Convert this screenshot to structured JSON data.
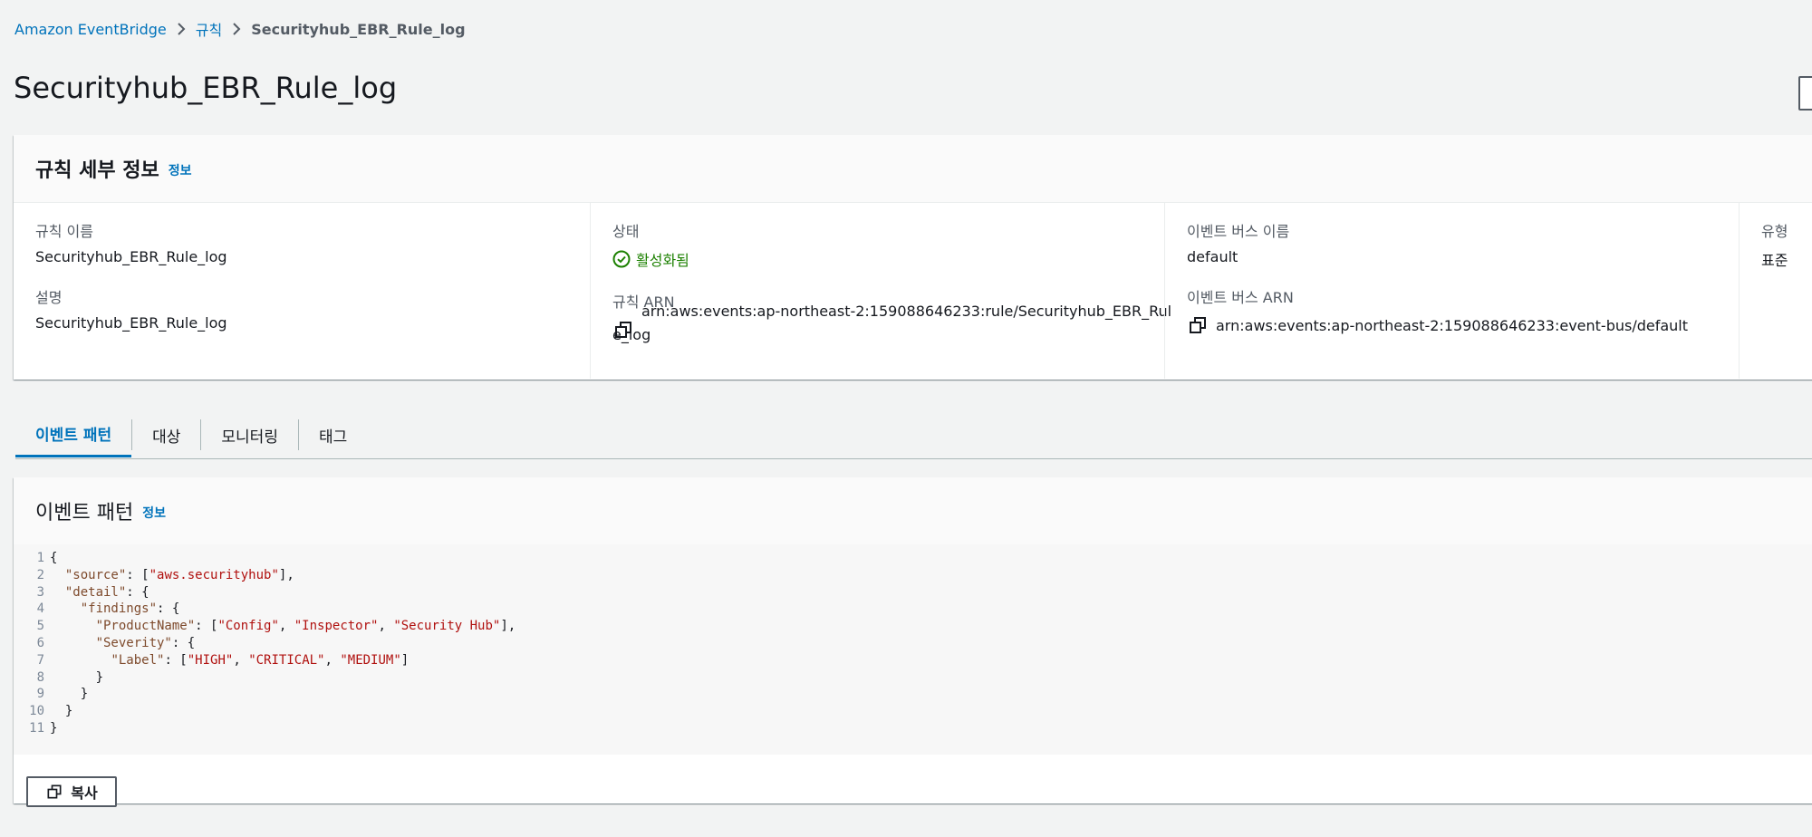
{
  "breadcrumb": {
    "items": [
      "Amazon EventBridge",
      "규칙"
    ],
    "current": "Securityhub_EBR_Rule_log"
  },
  "page_title": "Securityhub_EBR_Rule_log",
  "rule_details": {
    "title": "규칙 세부 정보",
    "info_label": "정보",
    "rule_name_label": "규칙 이름",
    "rule_name": "Securityhub_EBR_Rule_log",
    "description_label": "설명",
    "description": "Securityhub_EBR_Rule_log",
    "status_label": "상태",
    "status_value": "활성화됨",
    "rule_arn_label": "규칙 ARN",
    "rule_arn_line1": "arn:aws:events:ap-northeast-2:159088646233:rule/Securityhub_EBR_Rul",
    "rule_arn_line2": "e_log",
    "event_bus_name_label": "이벤트 버스 이름",
    "event_bus_name": "default",
    "event_bus_arn_label": "이벤트 버스 ARN",
    "event_bus_arn": "arn:aws:events:ap-northeast-2:159088646233:event-bus/default",
    "type_label": "유형",
    "type_value": "표준"
  },
  "tabs": [
    "이벤트 패턴",
    "대상",
    "모니터링",
    "태그"
  ],
  "event_pattern": {
    "title": "이벤트 패턴",
    "info_label": "정보",
    "line_numbers": [
      "1",
      "2",
      "3",
      "4",
      "5",
      "6",
      "7",
      "8",
      "9",
      "10",
      "11"
    ],
    "code_lines": [
      "{",
      "  \"source\": [\"aws.securityhub\"],",
      "  \"detail\": {",
      "    \"findings\": {",
      "      \"ProductName\": [\"Config\", \"Inspector\", \"Security Hub\"],",
      "      \"Severity\": {",
      "        \"Label\": [\"HIGH\", \"CRITICAL\", \"MEDIUM\"]",
      "      }",
      "    }",
      "  }",
      "}"
    ],
    "copy_button": "복사"
  },
  "colors": {
    "link": "#0073bb",
    "success": "#1d8102",
    "json_key": "#7e4a2c",
    "json_string": "#b0110f"
  }
}
